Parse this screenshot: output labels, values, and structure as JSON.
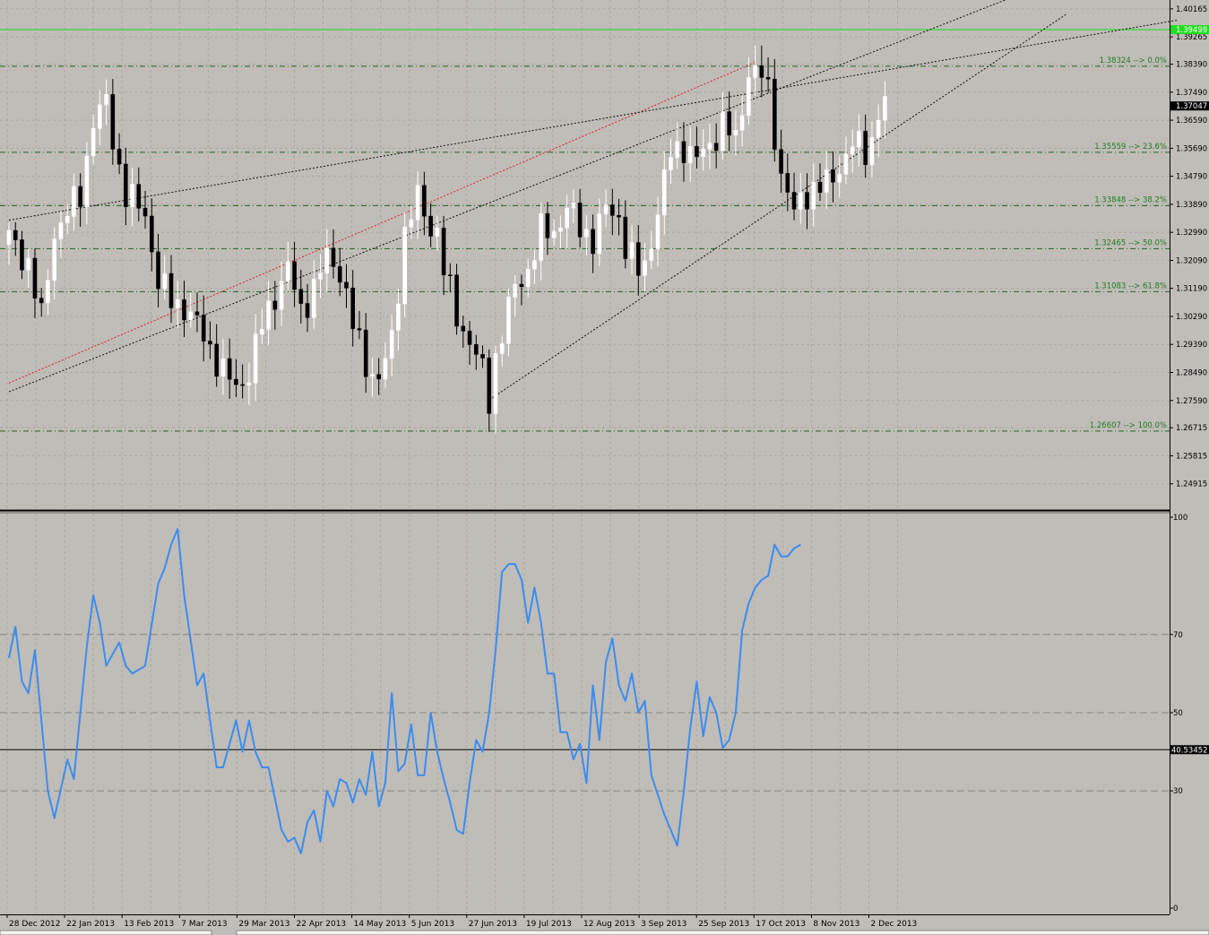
{
  "colors": {
    "background": "#c0bcb8",
    "grid": "#aaa6a2",
    "bull_candle": "#ffffff",
    "bear_candle": "#000000",
    "fib_line": "#1a6b1a",
    "fib_label": "#1f7f1f",
    "resistance_line": "#22dd22",
    "red_trend": "#e02020",
    "black_trend": "#111111",
    "stoch_line": "#3a8df0",
    "level_line": "#000000"
  },
  "chart_data": [
    {
      "type": "candlestick",
      "panel": "price",
      "ylim": [
        1.241,
        1.4045
      ],
      "y_ticks": [
        "1.40165",
        "1.39265",
        "1.38390",
        "1.37490",
        "1.36590",
        "1.35690",
        "1.34790",
        "1.33890",
        "1.32990",
        "1.32090",
        "1.31190",
        "1.30290",
        "1.29390",
        "1.28490",
        "1.27590",
        "1.26715",
        "1.25815",
        "1.24915"
      ],
      "current_price_label": "1.37047",
      "current_price": 1.37047,
      "resistance_label": "1.39499",
      "resistance": 1.39499,
      "fib_levels": [
        {
          "label": "1.38324 --> 0.0%",
          "value": 1.38324
        },
        {
          "label": "1.35559 --> 23.6%",
          "value": 1.35559
        },
        {
          "label": "1.33848 --> 38.2%",
          "value": 1.33848
        },
        {
          "label": "1.32465 --> 50.0%",
          "value": 1.32465
        },
        {
          "label": "1.31083 --> 61.8%",
          "value": 1.31083
        },
        {
          "label": "1.26607 --> 100.0%",
          "value": 1.26607
        }
      ],
      "trendlines": [
        {
          "color": "red",
          "from": [
            0,
            1.2815
          ],
          "to": [
            115,
            1.3845
          ]
        },
        {
          "color": "black",
          "from": [
            0,
            1.2787
          ],
          "to": [
            170,
            1.418
          ]
        },
        {
          "color": "black",
          "from": [
            0,
            1.3338
          ],
          "to": [
            180,
            1.398
          ]
        },
        {
          "color": "black",
          "from": [
            74,
            1.2761
          ],
          "to": [
            163,
            1.4
          ]
        }
      ],
      "close_path": [
        [
          0,
          1.328
        ],
        [
          3,
          1.32
        ],
        [
          5,
          1.302
        ],
        [
          7,
          1.33
        ],
        [
          9,
          1.336
        ],
        [
          11,
          1.342
        ],
        [
          13,
          1.366
        ],
        [
          15,
          1.371
        ],
        [
          16,
          1.36
        ],
        [
          18,
          1.342
        ],
        [
          21,
          1.336
        ],
        [
          23,
          1.314
        ],
        [
          25,
          1.308
        ],
        [
          27,
          1.306
        ],
        [
          29,
          1.3
        ],
        [
          31,
          1.293
        ],
        [
          33,
          1.285
        ],
        [
          35,
          1.28
        ],
        [
          37,
          1.285
        ],
        [
          39,
          1.3
        ],
        [
          41,
          1.31
        ],
        [
          43,
          1.318
        ],
        [
          45,
          1.305
        ],
        [
          47,
          1.312
        ],
        [
          49,
          1.322
        ],
        [
          51,
          1.318
        ],
        [
          53,
          1.3
        ],
        [
          55,
          1.288
        ],
        [
          57,
          1.282
        ],
        [
          59,
          1.295
        ],
        [
          61,
          1.33
        ],
        [
          63,
          1.341
        ],
        [
          64,
          1.335
        ],
        [
          66,
          1.33
        ],
        [
          67,
          1.318
        ],
        [
          69,
          1.303
        ],
        [
          71,
          1.295
        ],
        [
          73,
          1.285
        ],
        [
          74,
          1.276
        ],
        [
          75,
          1.29
        ],
        [
          77,
          1.305
        ],
        [
          78,
          1.312
        ],
        [
          80,
          1.318
        ],
        [
          82,
          1.33
        ],
        [
          84,
          1.33
        ],
        [
          86,
          1.338
        ],
        [
          88,
          1.331
        ],
        [
          90,
          1.328
        ],
        [
          92,
          1.337
        ],
        [
          94,
          1.335
        ],
        [
          95,
          1.326
        ],
        [
          97,
          1.317
        ],
        [
          98,
          1.319
        ],
        [
          100,
          1.337
        ],
        [
          102,
          1.355
        ],
        [
          104,
          1.358
        ],
        [
          106,
          1.353
        ],
        [
          108,
          1.358
        ],
        [
          110,
          1.365
        ],
        [
          112,
          1.359
        ],
        [
          114,
          1.382
        ],
        [
          115,
          1.381
        ],
        [
          116,
          1.38
        ],
        [
          117,
          1.375
        ],
        [
          118,
          1.362
        ],
        [
          119,
          1.348
        ],
        [
          120,
          1.343
        ],
        [
          121,
          1.335
        ],
        [
          122,
          1.341
        ],
        [
          124,
          1.344
        ],
        [
          126,
          1.345
        ],
        [
          128,
          1.351
        ],
        [
          130,
          1.358
        ],
        [
          132,
          1.356
        ],
        [
          133,
          1.36
        ],
        [
          134,
          1.368
        ],
        [
          135,
          1.371
        ]
      ],
      "x_tick_labels": [
        "28 Dec 2012",
        "22 Jan 2013",
        "13 Feb 2013",
        "7 Mar 2013",
        "29 Mar 2013",
        "22 Apr 2013",
        "14 May 2013",
        "5 Jun 2013",
        "27 Jun 2013",
        "19 Jul 2013",
        "12 Aug 2013",
        "3 Sep 2013",
        "25 Sep 2013",
        "17 Oct 2013",
        "8 Nov 2013",
        "2 Dec 2013"
      ],
      "bar_count": 136
    },
    {
      "type": "line",
      "panel": "stochastic",
      "ylim": [
        0,
        100
      ],
      "y_ticks": [
        "100",
        "70",
        "50",
        "30",
        "0"
      ],
      "level_label": "40.53452",
      "level": 40.53452,
      "series": [
        {
          "values": [
            [
              0,
              64
            ],
            [
              1,
              72
            ],
            [
              2,
              58
            ],
            [
              3,
              55
            ],
            [
              4,
              66
            ],
            [
              6,
              30
            ],
            [
              7,
              23
            ],
            [
              9,
              38
            ],
            [
              10,
              33
            ],
            [
              12,
              67
            ],
            [
              13,
              80
            ],
            [
              14,
              73
            ],
            [
              15,
              62
            ],
            [
              17,
              68
            ],
            [
              18,
              62
            ],
            [
              19,
              60
            ],
            [
              21,
              62
            ],
            [
              23,
              83
            ],
            [
              24,
              87
            ],
            [
              25,
              93
            ],
            [
              26,
              97
            ],
            [
              27,
              80
            ],
            [
              29,
              57
            ],
            [
              30,
              60
            ],
            [
              32,
              36
            ],
            [
              33,
              36
            ],
            [
              35,
              48
            ],
            [
              36,
              40
            ],
            [
              37,
              48
            ],
            [
              38,
              40
            ],
            [
              39,
              36
            ],
            [
              40,
              36
            ],
            [
              41,
              28
            ],
            [
              42,
              20
            ],
            [
              43,
              17
            ],
            [
              44,
              18
            ],
            [
              45,
              14
            ],
            [
              46,
              22
            ],
            [
              47,
              25
            ],
            [
              48,
              17
            ],
            [
              49,
              30
            ],
            [
              50,
              26
            ],
            [
              51,
              33
            ],
            [
              52,
              32
            ],
            [
              53,
              27
            ],
            [
              54,
              33
            ],
            [
              55,
              29
            ],
            [
              56,
              40
            ],
            [
              57,
              26
            ],
            [
              58,
              32
            ],
            [
              59,
              55
            ],
            [
              60,
              35
            ],
            [
              61,
              37
            ],
            [
              62,
              47
            ],
            [
              63,
              34
            ],
            [
              64,
              34
            ],
            [
              65,
              50
            ],
            [
              66,
              40
            ],
            [
              67,
              33
            ],
            [
              68,
              27
            ],
            [
              69,
              20
            ],
            [
              70,
              19
            ],
            [
              71,
              32
            ],
            [
              72,
              43
            ],
            [
              73,
              40
            ],
            [
              74,
              50
            ],
            [
              75,
              66
            ],
            [
              76,
              86
            ],
            [
              77,
              88
            ],
            [
              78,
              88
            ],
            [
              79,
              84
            ],
            [
              80,
              73
            ],
            [
              81,
              82
            ],
            [
              82,
              73
            ],
            [
              83,
              60
            ],
            [
              84,
              60
            ],
            [
              85,
              45
            ],
            [
              86,
              45
            ],
            [
              87,
              38
            ],
            [
              88,
              42
            ],
            [
              89,
              32
            ],
            [
              90,
              57
            ],
            [
              91,
              43
            ],
            [
              92,
              63
            ],
            [
              93,
              69
            ],
            [
              94,
              57
            ],
            [
              95,
              53
            ],
            [
              96,
              60
            ],
            [
              97,
              50
            ],
            [
              98,
              53
            ],
            [
              99,
              34
            ],
            [
              100,
              29
            ],
            [
              101,
              24
            ],
            [
              102,
              20
            ],
            [
              103,
              16
            ],
            [
              104,
              30
            ],
            [
              105,
              46
            ],
            [
              106,
              58
            ],
            [
              107,
              44
            ],
            [
              108,
              54
            ],
            [
              109,
              50
            ],
            [
              110,
              41
            ],
            [
              111,
              43
            ],
            [
              112,
              50
            ],
            [
              113,
              71
            ],
            [
              114,
              78
            ],
            [
              115,
              82
            ],
            [
              116,
              84
            ],
            [
              117,
              85
            ],
            [
              118,
              93
            ],
            [
              119,
              90
            ],
            [
              120,
              90
            ],
            [
              121,
              92
            ],
            [
              122,
              93
            ]
          ]
        }
      ]
    }
  ]
}
